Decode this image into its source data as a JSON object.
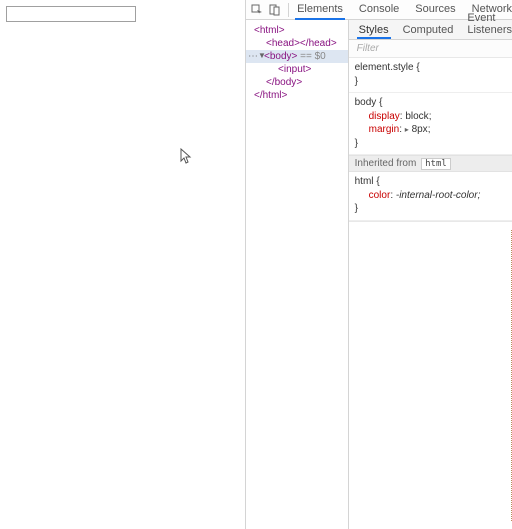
{
  "toolbar": {
    "tabs": [
      "Elements",
      "Console",
      "Sources",
      "Network"
    ],
    "active_tab": 0
  },
  "page": {
    "input_value": ""
  },
  "dom": {
    "lines": [
      {
        "indent": 0,
        "open": "html",
        "close": null
      },
      {
        "indent": 1,
        "open": "head",
        "close": "head"
      },
      {
        "indent": 0,
        "selected": true,
        "open": "body",
        "suffix": " == $0"
      },
      {
        "indent": 2,
        "open": "input",
        "self_close": true
      },
      {
        "indent": 1,
        "close_only": "body"
      },
      {
        "indent": 0,
        "close_only": "html"
      }
    ]
  },
  "styles": {
    "sub_tabs": [
      "Styles",
      "Computed",
      "Event Listeners"
    ],
    "active_sub_tab": 0,
    "filter_placeholder": "Filter",
    "rules": [
      {
        "selector": "element.style",
        "decls": []
      },
      {
        "selector": "body",
        "decls": [
          {
            "name": "display",
            "value": "block"
          },
          {
            "name": "margin",
            "value": "8px",
            "expandable": true
          }
        ]
      }
    ],
    "inherited_label": "Inherited from",
    "inherited_from": "html",
    "inherited_rule": {
      "selector": "html",
      "decls": [
        {
          "name": "color",
          "value": "-internal-root-color;"
        }
      ]
    }
  }
}
